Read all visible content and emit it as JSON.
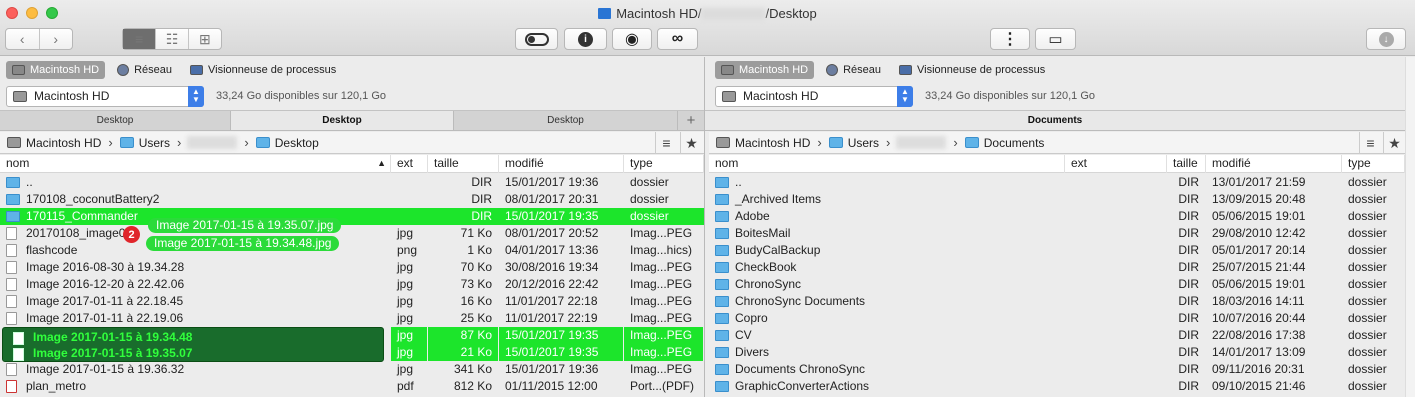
{
  "window": {
    "title_prefix": "Macintosh HD/",
    "title_suffix": "/Desktop"
  },
  "toolbar": {
    "back": "‹",
    "forward": "›",
    "info": "i",
    "eye": "◉",
    "binoculars": "∞",
    "zip": "⋮",
    "screen": "▭",
    "download": "↓"
  },
  "left": {
    "devices": [
      {
        "label": "Macintosh HD"
      },
      {
        "label": "Réseau"
      },
      {
        "label": "Visionneuse de processus"
      }
    ],
    "volume": "Macintosh HD",
    "free": "33,24 Go disponibles sur 120,1 Go",
    "tabs": [
      "Desktop",
      "Desktop",
      "Desktop"
    ],
    "path": {
      "root": "Macintosh HD",
      "users": "Users",
      "last": "Desktop"
    },
    "columns": {
      "name": "nom",
      "ext": "ext",
      "size": "taille",
      "modified": "modifié",
      "type": "type"
    },
    "rows": [
      {
        "name": "..",
        "ext": "",
        "size": "DIR",
        "modified": "15/01/2017 19:36",
        "type": "dossier",
        "kind": "fold"
      },
      {
        "name": "170108_coconutBattery2",
        "ext": "",
        "size": "DIR",
        "modified": "08/01/2017 20:31",
        "type": "dossier",
        "kind": "fold"
      },
      {
        "name": "170115_Commander",
        "ext": "",
        "size": "DIR",
        "modified": "15/01/2017 19:35",
        "type": "dossier",
        "kind": "fold",
        "hl": true
      },
      {
        "name": "20170108_image01",
        "ext": "jpg",
        "size": "71 Ko",
        "modified": "08/01/2017 20:52",
        "type": "Imag...PEG",
        "kind": "file"
      },
      {
        "name": "flashcode",
        "ext": "png",
        "size": "1 Ko",
        "modified": "04/01/2017 13:36",
        "type": "Imag...hics)",
        "kind": "file"
      },
      {
        "name": "Image 2016-08-30 à 19.34.28",
        "ext": "jpg",
        "size": "70 Ko",
        "modified": "30/08/2016 19:34",
        "type": "Imag...PEG",
        "kind": "file"
      },
      {
        "name": "Image 2016-12-20 à 22.42.06",
        "ext": "jpg",
        "size": "73 Ko",
        "modified": "20/12/2016 22:42",
        "type": "Imag...PEG",
        "kind": "file"
      },
      {
        "name": "Image 2017-01-11 à 22.18.45",
        "ext": "jpg",
        "size": "16 Ko",
        "modified": "11/01/2017 22:18",
        "type": "Imag...PEG",
        "kind": "file"
      },
      {
        "name": "Image 2017-01-11 à 22.19.06",
        "ext": "jpg",
        "size": "25 Ko",
        "modified": "11/01/2017 22:19",
        "type": "Imag...PEG",
        "kind": "file"
      },
      {
        "name": "Image 2017-01-15 à 19.34.48",
        "ext": "jpg",
        "size": "87 Ko",
        "modified": "15/01/2017 19:35",
        "type": "Imag...PEG",
        "kind": "file",
        "sel": true
      },
      {
        "name": "Image 2017-01-15 à 19.35.07",
        "ext": "jpg",
        "size": "21 Ko",
        "modified": "15/01/2017 19:35",
        "type": "Imag...PEG",
        "kind": "file",
        "sel": true
      },
      {
        "name": "Image 2017-01-15 à 19.36.32",
        "ext": "jpg",
        "size": "341 Ko",
        "modified": "15/01/2017 19:36",
        "type": "Imag...PEG",
        "kind": "file"
      },
      {
        "name": "plan_metro",
        "ext": "pdf",
        "size": "812 Ko",
        "modified": "01/11/2015 12:00",
        "type": "Port...(PDF)",
        "kind": "pdf"
      }
    ],
    "drag": {
      "count": "2",
      "item1": "Image 2017-01-15 à 19.35.07.jpg",
      "item2": "Image 2017-01-15 à 19.34.48.jpg"
    }
  },
  "right": {
    "devices": [
      {
        "label": "Macintosh HD"
      },
      {
        "label": "Réseau"
      },
      {
        "label": "Visionneuse de processus"
      }
    ],
    "volume": "Macintosh HD",
    "free": "33,24 Go disponibles sur 120,1 Go",
    "tabs": [
      "Documents"
    ],
    "path": {
      "root": "Macintosh HD",
      "users": "Users",
      "last": "Documents"
    },
    "columns": {
      "name": "nom",
      "ext": "ext",
      "size": "taille",
      "modified": "modifié",
      "type": "type"
    },
    "rows": [
      {
        "name": "..",
        "ext": "",
        "size": "DIR",
        "modified": "13/01/2017 21:59",
        "type": "dossier"
      },
      {
        "name": "_Archived Items",
        "ext": "",
        "size": "DIR",
        "modified": "13/09/2015 20:48",
        "type": "dossier"
      },
      {
        "name": "Adobe",
        "ext": "",
        "size": "DIR",
        "modified": "05/06/2015 19:01",
        "type": "dossier"
      },
      {
        "name": "BoitesMail",
        "ext": "",
        "size": "DIR",
        "modified": "29/08/2010 12:42",
        "type": "dossier"
      },
      {
        "name": "BudyCalBackup",
        "ext": "",
        "size": "DIR",
        "modified": "05/01/2017 20:14",
        "type": "dossier"
      },
      {
        "name": "CheckBook",
        "ext": "",
        "size": "DIR",
        "modified": "25/07/2015 21:44",
        "type": "dossier"
      },
      {
        "name": "ChronoSync",
        "ext": "",
        "size": "DIR",
        "modified": "05/06/2015 19:01",
        "type": "dossier"
      },
      {
        "name": "ChronoSync Documents",
        "ext": "",
        "size": "DIR",
        "modified": "18/03/2016 14:11",
        "type": "dossier"
      },
      {
        "name": "Copro",
        "ext": "",
        "size": "DIR",
        "modified": "10/07/2016 20:44",
        "type": "dossier"
      },
      {
        "name": "CV",
        "ext": "",
        "size": "DIR",
        "modified": "22/08/2016 17:38",
        "type": "dossier"
      },
      {
        "name": "Divers",
        "ext": "",
        "size": "DIR",
        "modified": "14/01/2017 13:09",
        "type": "dossier"
      },
      {
        "name": "Documents ChronoSync",
        "ext": "",
        "size": "DIR",
        "modified": "09/11/2016 20:31",
        "type": "dossier"
      },
      {
        "name": "GraphicConverterActions",
        "ext": "",
        "size": "DIR",
        "modified": "09/10/2015 21:46",
        "type": "dossier"
      }
    ]
  },
  "colors": {
    "highlight": "#1ce52b",
    "selection": "#196c2c",
    "folder": "#5fb3e8",
    "badge": "#e0252b"
  }
}
